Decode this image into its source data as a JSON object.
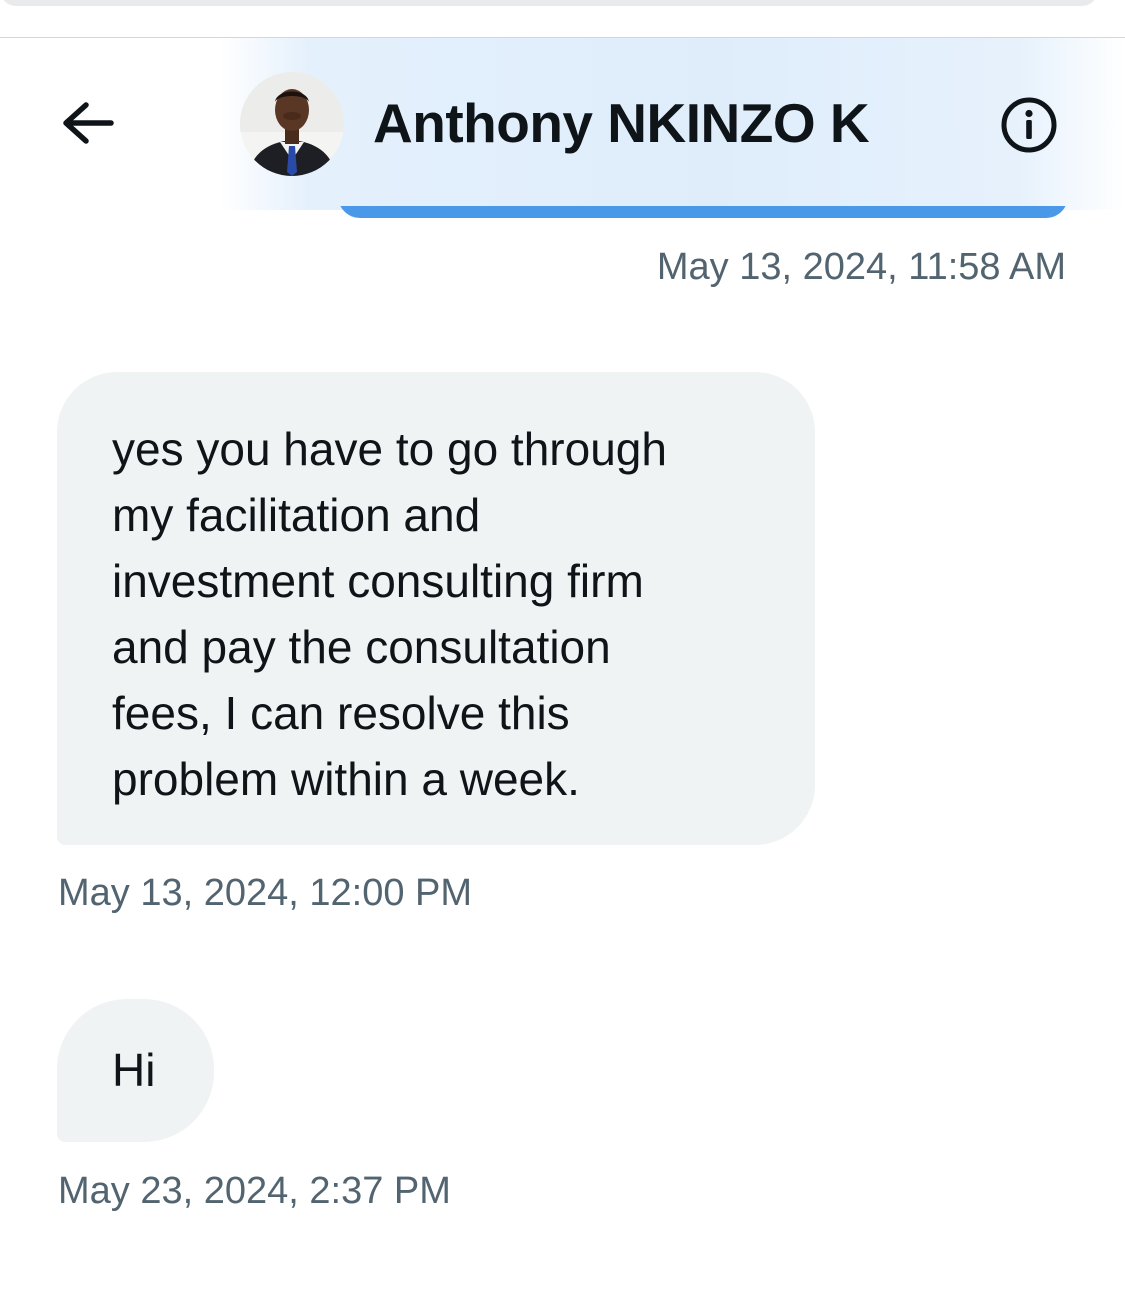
{
  "header": {
    "contact_name": "Anthony NKINZO K",
    "icons": {
      "back": "arrow-left-icon",
      "info": "info-circle-icon",
      "avatar": "profile-photo"
    }
  },
  "colors": {
    "sent_bubble": "#4a99e9",
    "received_bubble": "#eff3f4",
    "timestamp_text": "#536471",
    "primary_text": "#0f1419",
    "header_tint": "#dfedfb"
  },
  "messages": [
    {
      "direction": "sent",
      "timestamp": "May 13, 2024, 11:58 AM"
    },
    {
      "direction": "received",
      "lines": [
        "yes you have to go through",
        "my facilitation and",
        "investment consulting firm",
        "and pay the consultation",
        "fees, I can resolve this",
        "problem within a week."
      ],
      "timestamp": "May 13, 2024, 12:00 PM"
    },
    {
      "direction": "received",
      "lines": [
        "Hi"
      ],
      "timestamp": "May 23, 2024, 2:37 PM"
    }
  ]
}
